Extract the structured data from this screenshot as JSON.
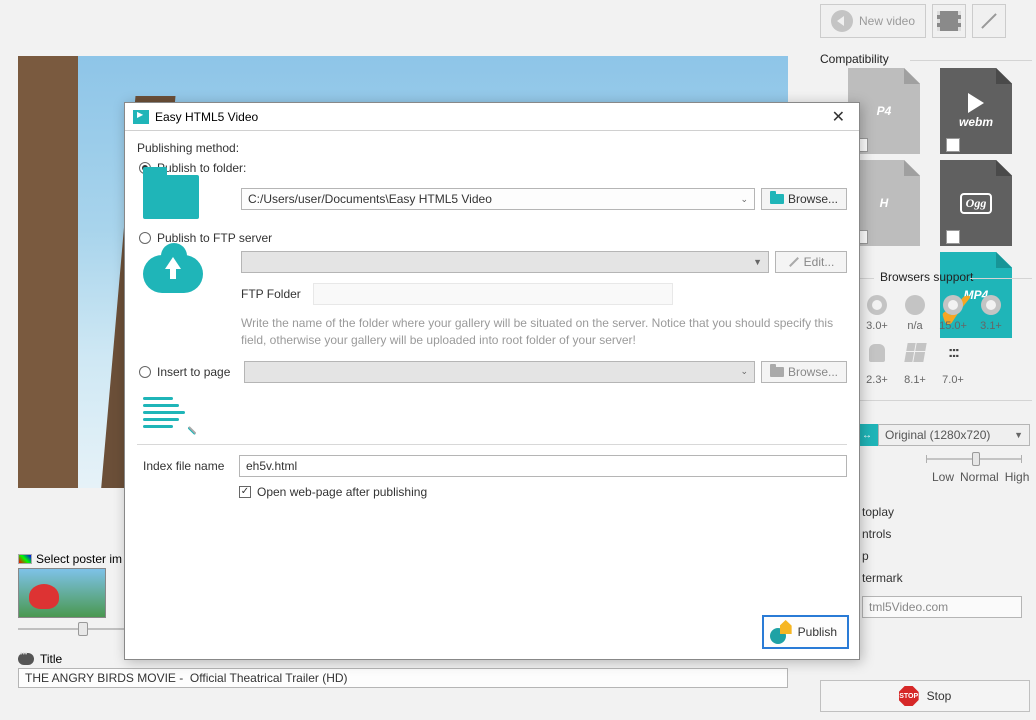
{
  "main": {
    "select_poster_label": "Select poster im",
    "title_label": "Title",
    "title_value": "THE ANGRY BIRDS MOVIE -  Official Theatrical Trailer (HD)"
  },
  "right": {
    "new_video": "New video",
    "compat": "Compatibility",
    "formats": {
      "mp4": "P4",
      "webm": "webm",
      "h": "H",
      "ogg": "Ogg",
      "mp4low": "MP4"
    },
    "browsers_support": "Browsers support",
    "brow1": [
      "3.0+",
      "n/a",
      "15.0+",
      "3.1+"
    ],
    "brow2": [
      "2.3+",
      "8.1+",
      "7.0+"
    ],
    "size_value": "Original (1280x720)",
    "quality": {
      "low": "Low",
      "normal": "Normal",
      "high": "High"
    },
    "opts": {
      "autoplay": "toplay",
      "controls": "ntrols",
      "loop": "p",
      "watermark": "termark"
    },
    "wm_value": "tml5Video.com",
    "stop": "Stop"
  },
  "dialog": {
    "title": "Easy HTML5 Video",
    "publishing_method": "Publishing method:",
    "publish_folder_label": "Publish to folder:",
    "folder_path": "C:/Users/user/Documents\\Easy HTML5 Video",
    "browse": "Browse...",
    "publish_ftp_label": "Publish to FTP server",
    "edit": "Edit...",
    "ftp_folder_label": "FTP Folder",
    "ftp_help": "Write the name of the folder where your gallery will be situated on the server. Notice that you should specify this field, otherwise your gallery will be uploaded into root folder of your server!",
    "insert_to_page": "Insert to page",
    "index_file_label": "Index file name",
    "index_file_value": "eh5v.html",
    "open_after": "Open web-page after publishing",
    "publish": "Publish"
  }
}
